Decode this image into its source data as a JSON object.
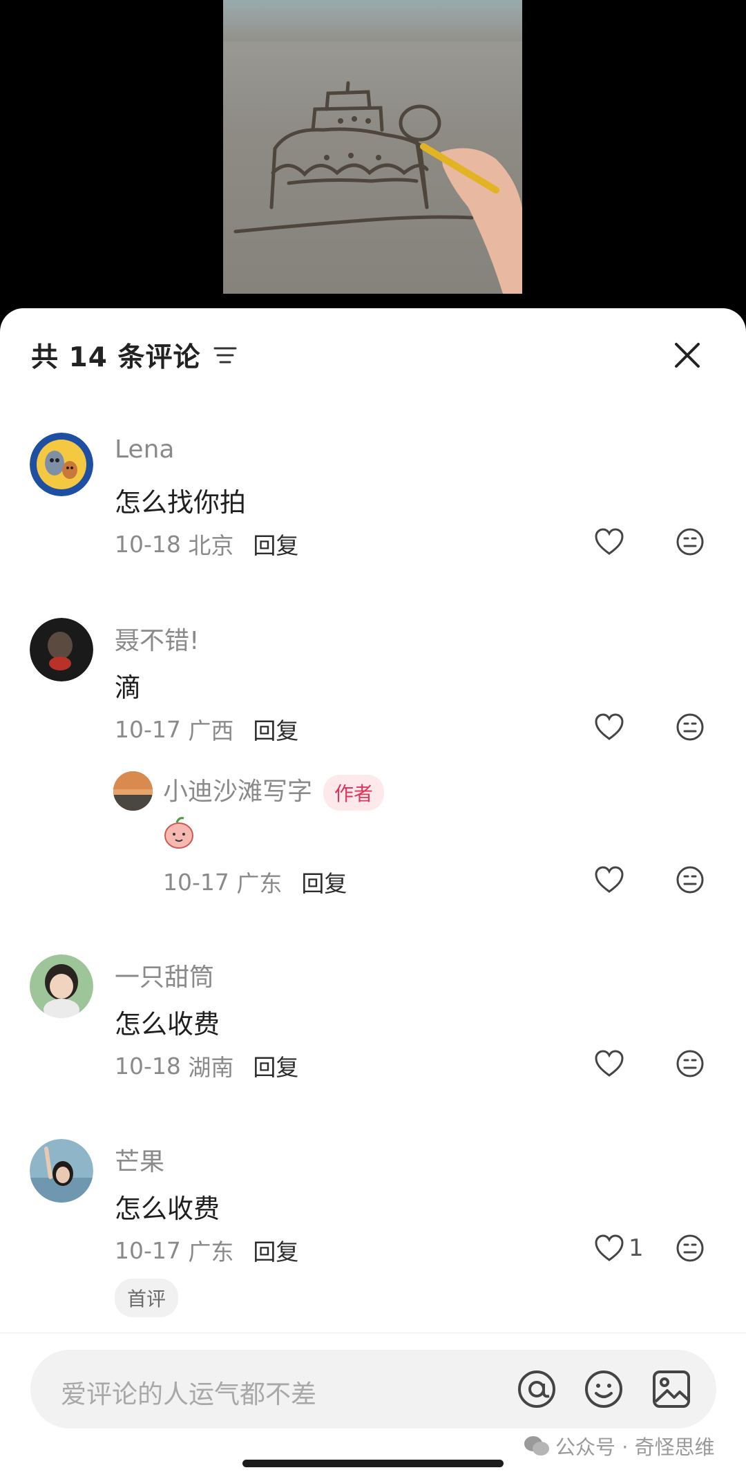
{
  "header": {
    "title_prefix": "共",
    "comment_count": "14",
    "title_suffix": "条评论"
  },
  "comments": [
    {
      "name": "Lena",
      "text": "怎么找你拍",
      "date": "10-18",
      "location": "北京",
      "reply_label": "回复",
      "avatar": "tom-and-jerry-avatar"
    },
    {
      "name": "聂不错!",
      "text": "滴",
      "date": "10-17",
      "location": "广西",
      "reply_label": "回复",
      "avatar": "dark-portrait-avatar",
      "replies": [
        {
          "name": "小迪沙滩写字",
          "tag": "作者",
          "text_icon": "peach-sticker-icon",
          "date": "10-17",
          "location": "广东",
          "reply_label": "回复",
          "avatar": "sunset-beach-avatar"
        }
      ]
    },
    {
      "name": "一只甜筒",
      "text": "怎么收费",
      "date": "10-18",
      "location": "湖南",
      "reply_label": "回复",
      "avatar": "child-avatar"
    },
    {
      "name": "芒果",
      "text": "怎么收费",
      "date": "10-17",
      "location": "广东",
      "reply_label": "回复",
      "like_count": "1",
      "badge": "首评",
      "avatar": "sea-portrait-avatar"
    }
  ],
  "input": {
    "placeholder": "爱评论的人运气都不差"
  },
  "watermark": {
    "text": "公众号 · 奇怪思维"
  },
  "colors": {
    "author_tag_bg": "#fde9ec",
    "author_tag_text": "#e0345a",
    "meta_gray": "#8a8a8a"
  }
}
